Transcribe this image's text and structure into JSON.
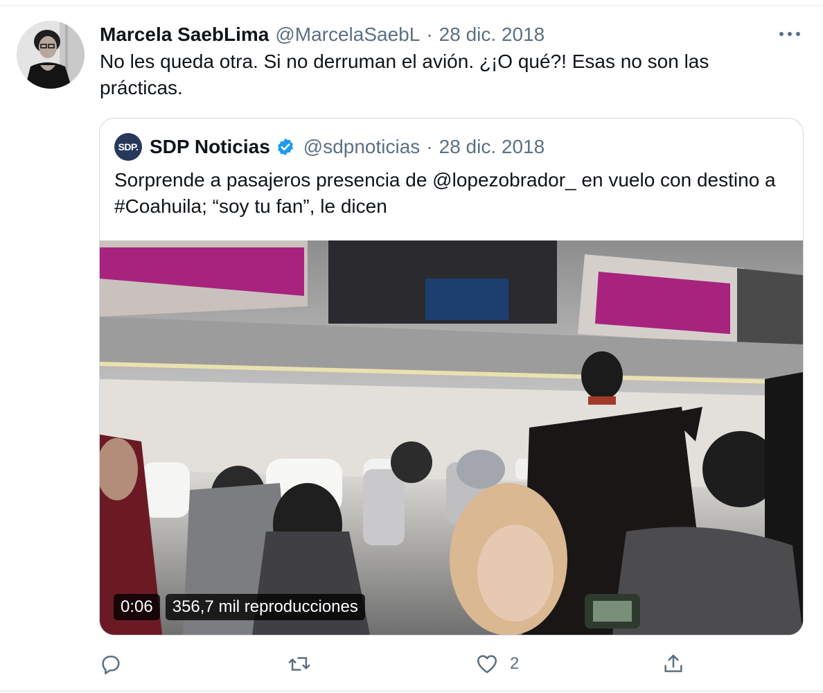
{
  "tweet": {
    "author_name": "Marcela SaebLima",
    "author_handle": "@MarcelaSaebL",
    "separator": "·",
    "date": "28 dic. 2018",
    "text": "No les queda otra.  Si no derruman el avión. ¿¡O qué?! Esas no son las prácticas."
  },
  "quoted_tweet": {
    "avatar_text": "SDP.",
    "name": "SDP Noticias",
    "handle": "@sdpnoticias",
    "separator": "·",
    "date": "28 dic. 2018",
    "text": "Sorprende a pasajeros presencia de @lopezobrador_ en vuelo con destino a #Coahuila; “soy tu fan”, le dicen",
    "video": {
      "duration": "0:06",
      "views": "356,7 mil reproducciones"
    }
  },
  "actions": {
    "like_count": "2"
  },
  "icons": {
    "more": "more-horizontal-icon",
    "reply": "reply-icon",
    "retweet": "retweet-icon",
    "like": "heart-icon",
    "share": "share-icon",
    "verified": "verified-badge-icon"
  },
  "colors": {
    "text": "#0f1419",
    "secondary": "#5b7083",
    "border": "#cfd9de",
    "verified": "#1d9bf0",
    "sdp_avatar": "#27385c"
  }
}
